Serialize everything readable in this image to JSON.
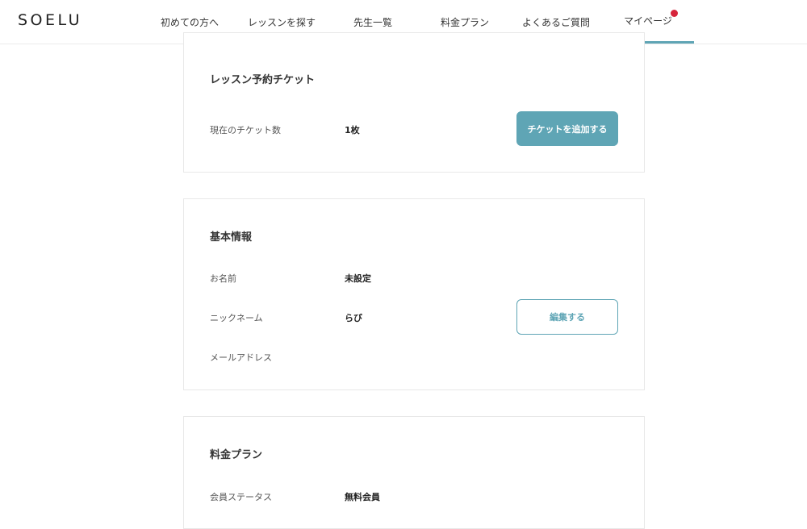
{
  "brand": {
    "logo": "SOELU"
  },
  "nav": {
    "items": [
      {
        "label": "初めての方へ"
      },
      {
        "label": "レッスンを探す"
      },
      {
        "label": "先生一覧"
      },
      {
        "label": "料金プラン"
      },
      {
        "label": "よくあるご質問"
      },
      {
        "label": "マイページ"
      }
    ]
  },
  "ticket_card": {
    "title": "レッスン予約チケット",
    "count_label": "現在のチケット数",
    "count_value": "1枚",
    "add_button": "チケットを追加する"
  },
  "profile_card": {
    "title": "基本情報",
    "name_label": "お名前",
    "name_value": "未設定",
    "nickname_label": "ニックネーム",
    "nickname_value": "らび",
    "email_label": "メールアドレス",
    "edit_button": "編集する"
  },
  "plan_card": {
    "title": "料金プラン",
    "status_label": "会員ステータス",
    "status_value": "無料会員"
  },
  "colors": {
    "accent": "#5fa5b5",
    "notification": "#d6243b"
  }
}
